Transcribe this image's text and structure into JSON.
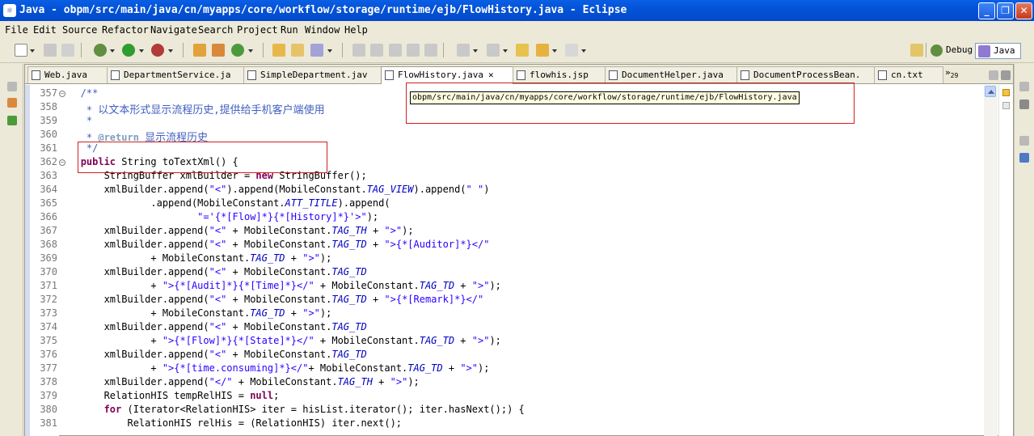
{
  "window": {
    "title": "Java - obpm/src/main/java/cn/myapps/core/workflow/storage/runtime/ejb/FlowHistory.java - Eclipse",
    "controls": [
      "_",
      "❐",
      "✕"
    ]
  },
  "menu": [
    "File",
    "Edit",
    "Source",
    "Refactor",
    "Navigate",
    "Search",
    "Project",
    "Run",
    "Window",
    "Help"
  ],
  "perspectives": {
    "debug": "Debug",
    "java": "Java"
  },
  "tabs": [
    {
      "label": "Web.java",
      "active": false
    },
    {
      "label": "DepartmentService.ja",
      "active": false
    },
    {
      "label": "SimpleDepartment.jav",
      "active": false
    },
    {
      "label": "FlowHistory.java",
      "active": true
    },
    {
      "label": "flowhis.jsp",
      "active": false
    },
    {
      "label": "DocumentHelper.java",
      "active": false
    },
    {
      "label": "DocumentProcessBean.",
      "active": false
    },
    {
      "label": "cn.txt",
      "active": false
    }
  ],
  "tab_overflow": {
    "symbol": "»",
    "count": "29"
  },
  "tooltip": "obpm/src/main/java/cn/myapps/core/workflow/storage/runtime/ejb/FlowHistory.java",
  "lines": [
    {
      "n": "357",
      "fold": true,
      "t": "   /**"
    },
    {
      "n": "358",
      "t": "    * 以文本形式显示流程历史,提供给手机客户端使用"
    },
    {
      "n": "359",
      "t": "    *"
    },
    {
      "n": "360",
      "t": "    * @return 显示流程历史"
    },
    {
      "n": "361",
      "t": "    */"
    },
    {
      "n": "362",
      "fold": true,
      "t": "   public String toTextXml() {"
    },
    {
      "n": "363",
      "t": "       StringBuffer xmlBuilder = new StringBuffer();"
    },
    {
      "n": "364",
      "t": "       xmlBuilder.append(\"<\").append(MobileConstant.TAG_VIEW).append(\" \")"
    },
    {
      "n": "365",
      "t": "               .append(MobileConstant.ATT_TITLE).append("
    },
    {
      "n": "366",
      "t": "                       \"='{*[Flow]*}{*[History]*}'>\");"
    },
    {
      "n": "367",
      "t": "       xmlBuilder.append(\"<\" + MobileConstant.TAG_TH + \">\");"
    },
    {
      "n": "368",
      "t": "       xmlBuilder.append(\"<\" + MobileConstant.TAG_TD + \">{*[Auditor]*}</\""
    },
    {
      "n": "369",
      "t": "               + MobileConstant.TAG_TD + \">\");"
    },
    {
      "n": "370",
      "t": "       xmlBuilder.append(\"<\" + MobileConstant.TAG_TD"
    },
    {
      "n": "371",
      "t": "               + \">{*[Audit]*}{*[Time]*}</\" + MobileConstant.TAG_TD + \">\");"
    },
    {
      "n": "372",
      "t": "       xmlBuilder.append(\"<\" + MobileConstant.TAG_TD + \">{*[Remark]*}</\""
    },
    {
      "n": "373",
      "t": "               + MobileConstant.TAG_TD + \">\");"
    },
    {
      "n": "374",
      "t": "       xmlBuilder.append(\"<\" + MobileConstant.TAG_TD"
    },
    {
      "n": "375",
      "t": "               + \">{*[Flow]*}{*[State]*}</\" + MobileConstant.TAG_TD + \">\");"
    },
    {
      "n": "376",
      "t": "       xmlBuilder.append(\"<\" + MobileConstant.TAG_TD"
    },
    {
      "n": "377",
      "t": "               + \">{*[time.consuming]*}</\"+ MobileConstant.TAG_TD + \">\");"
    },
    {
      "n": "378",
      "t": "       xmlBuilder.append(\"</\" + MobileConstant.TAG_TH + \">\");"
    },
    {
      "n": "379",
      "t": "       RelationHIS tempRelHIS = null;"
    },
    {
      "n": "380",
      "t": "       for (Iterator<RelationHIS> iter = hisList.iterator(); iter.hasNext();) {"
    },
    {
      "n": "381",
      "t": "           RelationHIS relHis = (RelationHIS) iter.next();"
    }
  ],
  "colors": {
    "keyword": "#7f0055",
    "string": "#2a00ff",
    "javadoc": "#3f5fbf",
    "static_field": "#0000c0",
    "annotation_box": "#d21f1f"
  }
}
